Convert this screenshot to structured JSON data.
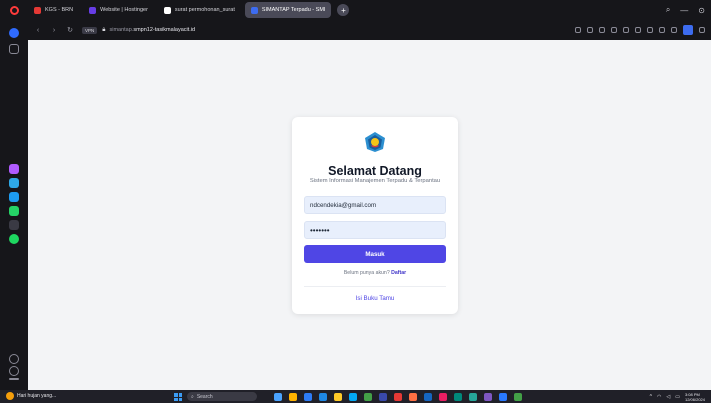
{
  "browser": {
    "tabs": [
      {
        "label": "KGS - BRN",
        "favicon_color": "#e53935",
        "active": false
      },
      {
        "label": "Website | Hostinger",
        "favicon_color": "#673de6",
        "active": false
      },
      {
        "label": "surat permohonan_surat",
        "favicon_color": "#ffffff",
        "active": false
      },
      {
        "label": "SIMANTAP Terpadu - SMI",
        "favicon_color": "#3d6cf0",
        "active": true
      }
    ],
    "add_tab_symbol": "+",
    "window_controls": {
      "search": "⌕",
      "minimize": "—",
      "pin": "⊙"
    },
    "address": {
      "tag": "VPN",
      "url_prefix": "simantap.",
      "url_domain": "smpn12-tasikmalayacit.id"
    },
    "nav": {
      "back": "‹",
      "forward": "›",
      "reload": "↻"
    }
  },
  "sidebar_icons": [
    {
      "name": "messenger-icon",
      "color": "#b05bff"
    },
    {
      "name": "telegram-icon",
      "color": "#2ea8e6"
    },
    {
      "name": "twitter-icon",
      "color": "#1d9bf0"
    },
    {
      "name": "whatsapp-icon",
      "color": "#25d366"
    },
    {
      "name": "tiktok-icon",
      "color": "#2b2b33"
    },
    {
      "name": "spotify-icon",
      "color": "#1ed760"
    }
  ],
  "login": {
    "title": "Selamat Datang",
    "subtitle": "Sistem Informasi Manajemen Terpadu & Terpantau",
    "email_value": "ndcendekia@gmail.com",
    "password_mask": "•••••••",
    "submit_label": "Masuk",
    "register_prompt": "Belum punya akun?",
    "register_link": "Daftar",
    "guestbook_link": "Isi Buku Tamu"
  },
  "taskbar": {
    "weather_text": "Hari hujan yang...",
    "search_placeholder": "Search",
    "time": "3:08 PM",
    "date": "12/06/2024",
    "apps": [
      "#4aa3ff",
      "#ffb300",
      "#2d7cf6",
      "#1e88e5",
      "#ffca28",
      "#03a9f4",
      "#43a047",
      "#3949ab",
      "#e53935",
      "#ff7043",
      "#1565c0",
      "#e91e63",
      "#00897b",
      "#26a69a",
      "#7e57c2",
      "#2979ff",
      "#43a047"
    ]
  }
}
